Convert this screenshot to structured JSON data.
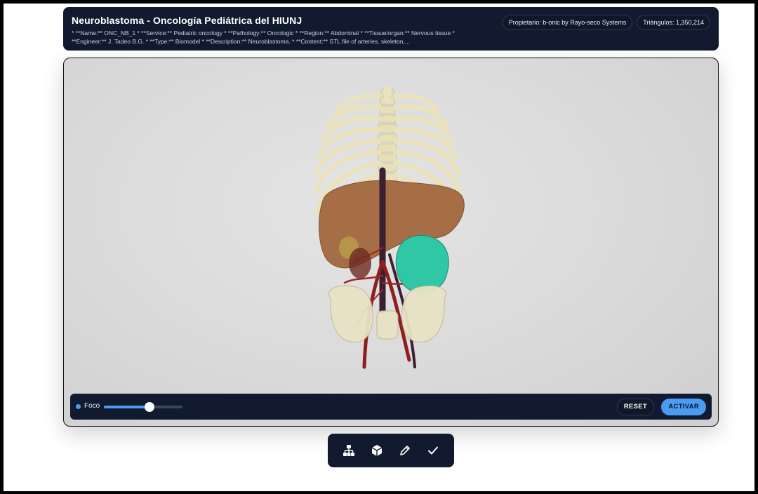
{
  "header": {
    "title": "Neuroblastoma - Oncología Pediátrica del HIUNJ",
    "description": "* **Name:** ONC_NB_1 * **Service:** Pediatric oncology * **Pathology:** Oncologic * **Region:** Abdominal * **Tissue/organ:** Nervous tissue * **Engineer:** J. Tadeo B.G. * **Type:** Biomodel * **Description:** Neuroblastoma. * **Content:** STL file of arteries, skeleton,...",
    "owner": "Propietario: b-onic by Rayo-seco Systems",
    "triangles": "Triángulos: 1,350,214"
  },
  "viewer": {
    "focus_label": "Foco",
    "focus_level": 0.58,
    "reset_label": "RESET",
    "activate_label": "ACTIVAR"
  },
  "tools": [
    {
      "name": "hierarchy-icon"
    },
    {
      "name": "cube-icon"
    },
    {
      "name": "pencil-icon"
    },
    {
      "name": "check-icon"
    }
  ],
  "colors": {
    "panel": "#111a2e",
    "accent": "#4a9cf2",
    "tumor": "#2fc7a6",
    "liver": "#9c5a2c",
    "bone": "#e8e2bf",
    "artery": "#8e1f1f"
  }
}
